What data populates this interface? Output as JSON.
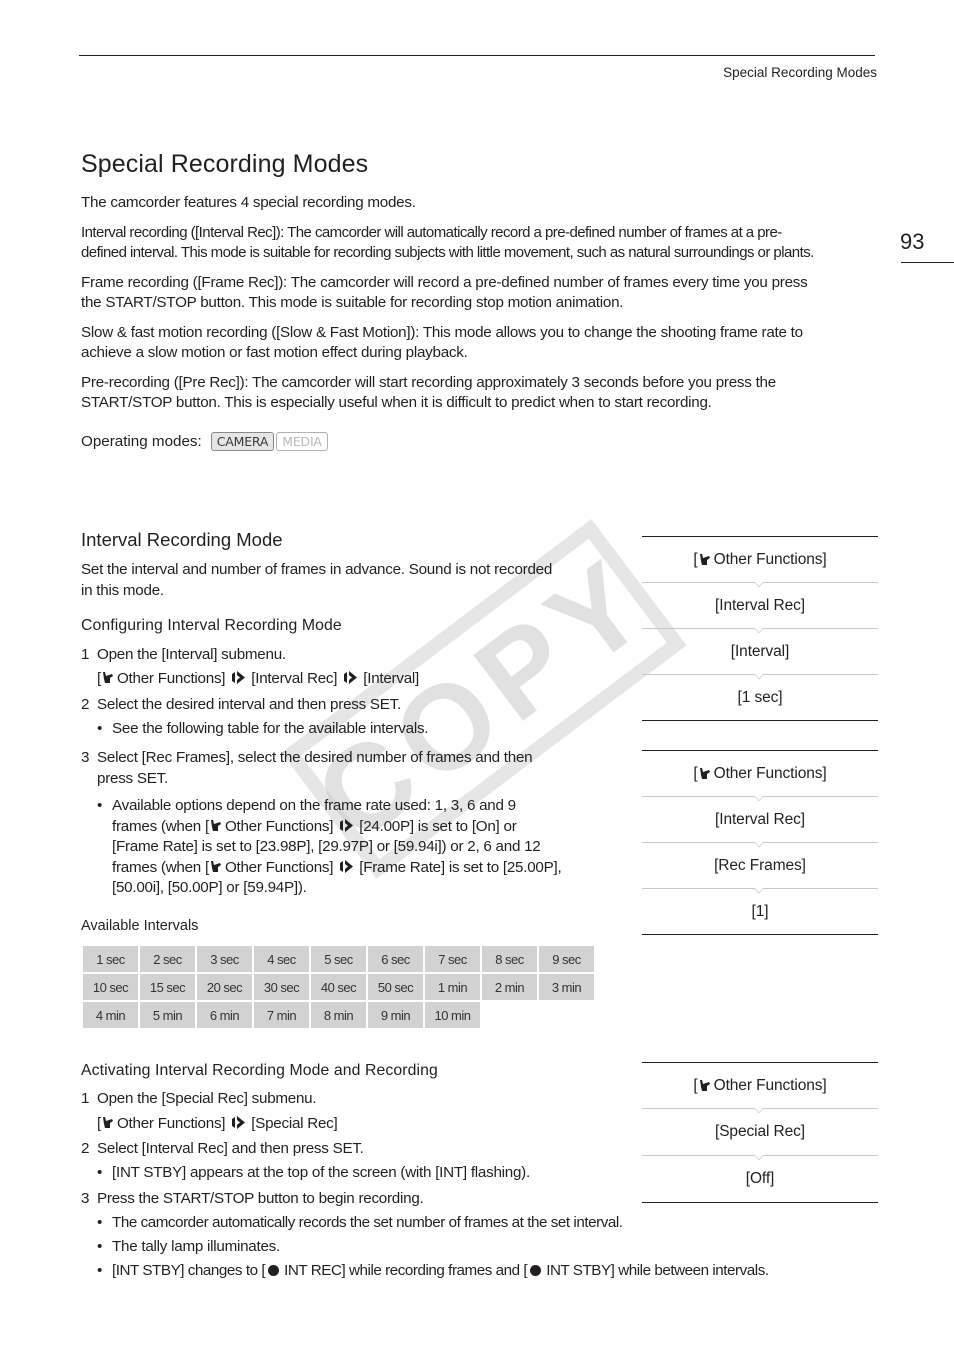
{
  "header": {
    "running_head": "Special Recording Modes",
    "page_number": "93"
  },
  "title": "Special Recording Modes",
  "intro": {
    "lead": "The camcorder features 4 special recording modes.",
    "modes": [
      "Interval recording ([Interval Rec]): The camcorder will automatically record a pre-defined number of frames at a pre-defined interval. This mode is suitable for recording subjects with little movement, such as natural surroundings or plants.",
      "Frame recording ([Frame Rec]): The camcorder will record a pre-defined number of frames every time you press the START/STOP button. This mode is suitable for recording stop motion animation.",
      "Slow & fast motion recording ([Slow & Fast Motion]): This mode allows you to change the shooting frame rate to achieve a slow motion or fast motion effect during playback.",
      "Pre-recording ([Pre Rec]): The camcorder will start recording approximately 3 seconds before you press the START/STOP button. This is especially useful when it is difficult to predict when to start recording."
    ],
    "mode_lines": [
      [
        "Interval recording ([Interval Rec]): The camcorder will automatically record a pre-defined number of frames at a pre-",
        "defined interval. This mode is suitable for recording subjects with little movement, such as natural surroundings or plants."
      ],
      [
        "Frame recording ([Frame Rec]): The camcorder will record a pre-defined number of frames every time you press",
        "the START/STOP button. This mode is suitable for recording stop motion animation."
      ],
      [
        "Slow & fast motion recording ([Slow & Fast Motion]): This mode allows you to change the shooting frame rate to",
        "achieve a slow motion or fast motion effect during playback."
      ],
      [
        "Pre-recording ([Pre Rec]): The camcorder will start recording approximately 3 seconds before you press the",
        "START/STOP button. This is especially useful when it is difficult to predict when to start recording."
      ]
    ],
    "operating_modes_label": "Operating modes:",
    "operating_modes": [
      {
        "label": "CAMERA",
        "active": true
      },
      {
        "label": "MEDIA",
        "active": false
      }
    ]
  },
  "watermark": "COPY",
  "interval_section": {
    "heading": "Interval Recording Mode",
    "desc_lines": [
      "Set the interval and number of frames in advance. Sound is not recorded",
      "in this mode."
    ],
    "config_heading": "Configuring Interval Recording Mode",
    "step1": {
      "num": "1",
      "text": "Open the [Interval] submenu."
    },
    "step1_path": [
      "Other Functions]",
      "[Interval Rec]",
      "[Interval]"
    ],
    "step2": {
      "num": "2",
      "text": "Select the desired interval and then press SET."
    },
    "step2_bullet": "See the following table for the available intervals.",
    "step3": {
      "num": "3",
      "lines": [
        "Select [Rec Frames], select the desired number of frames and then",
        "press SET."
      ]
    },
    "step3_bullet": {
      "line1": "Available options depend on the frame rate used: 1, 3, 6 and 9",
      "line2_pre": "frames (when [",
      "line2_a": "Other Functions]",
      "line2_b": "[24.00P] is set to [On] or",
      "line3": "[Frame Rate] is set to [23.98P], [29.97P] or [59.94i]) or 2, 6 and 12",
      "line4_pre": "frames (when [",
      "line4_a": "Other Functions]",
      "line4_b": "[Frame Rate] is set to [25.00P],",
      "line5": "[50.00i], [50.00P] or [59.94P])."
    },
    "intervals_label": "Available Intervals",
    "intervals": [
      [
        "1 sec",
        "2 sec",
        "3 sec",
        "4 sec",
        "5 sec",
        "6 sec",
        "7 sec",
        "8 sec",
        "9 sec"
      ],
      [
        "10 sec",
        "15 sec",
        "20 sec",
        "30 sec",
        "40 sec",
        "50 sec",
        "1 min",
        "2 min",
        "3 min"
      ],
      [
        "4 min",
        "5 min",
        "6 min",
        "7 min",
        "8 min",
        "9 min",
        "10 min",
        "",
        ""
      ]
    ],
    "menu_path_1": [
      "[",
      "Other Functions]",
      "[Interval Rec]",
      "[Interval]",
      "[1 sec]"
    ],
    "menu_path_2": [
      "[",
      "Other Functions]",
      "[Interval Rec]",
      "[Rec Frames]",
      "[1]"
    ]
  },
  "activate_section": {
    "heading": "Activating Interval Recording Mode and Recording",
    "step1": {
      "num": "1",
      "text": "Open the [Special Rec] submenu."
    },
    "step1_path": [
      "Other Functions]",
      "[Special Rec]"
    ],
    "step2": {
      "num": "2",
      "text": "Select [Interval Rec] and then press SET."
    },
    "step2_bullet": "[INT STBY] appears at the top of the screen (with [INT] flashing).",
    "step3": {
      "num": "3",
      "text": "Press the START/STOP button to begin recording."
    },
    "step3_bullets": [
      "The camcorder automatically records the set number of frames at the set interval.",
      "The tally lamp illuminates."
    ],
    "step3_bullet3": {
      "a": "[INT STBY] changes to [",
      "b": "INT REC] while recording frames and [",
      "c": "INT STBY] while between intervals."
    },
    "menu_path": [
      "[",
      "Other Functions]",
      "[Special Rec]",
      "[Off]"
    ]
  }
}
